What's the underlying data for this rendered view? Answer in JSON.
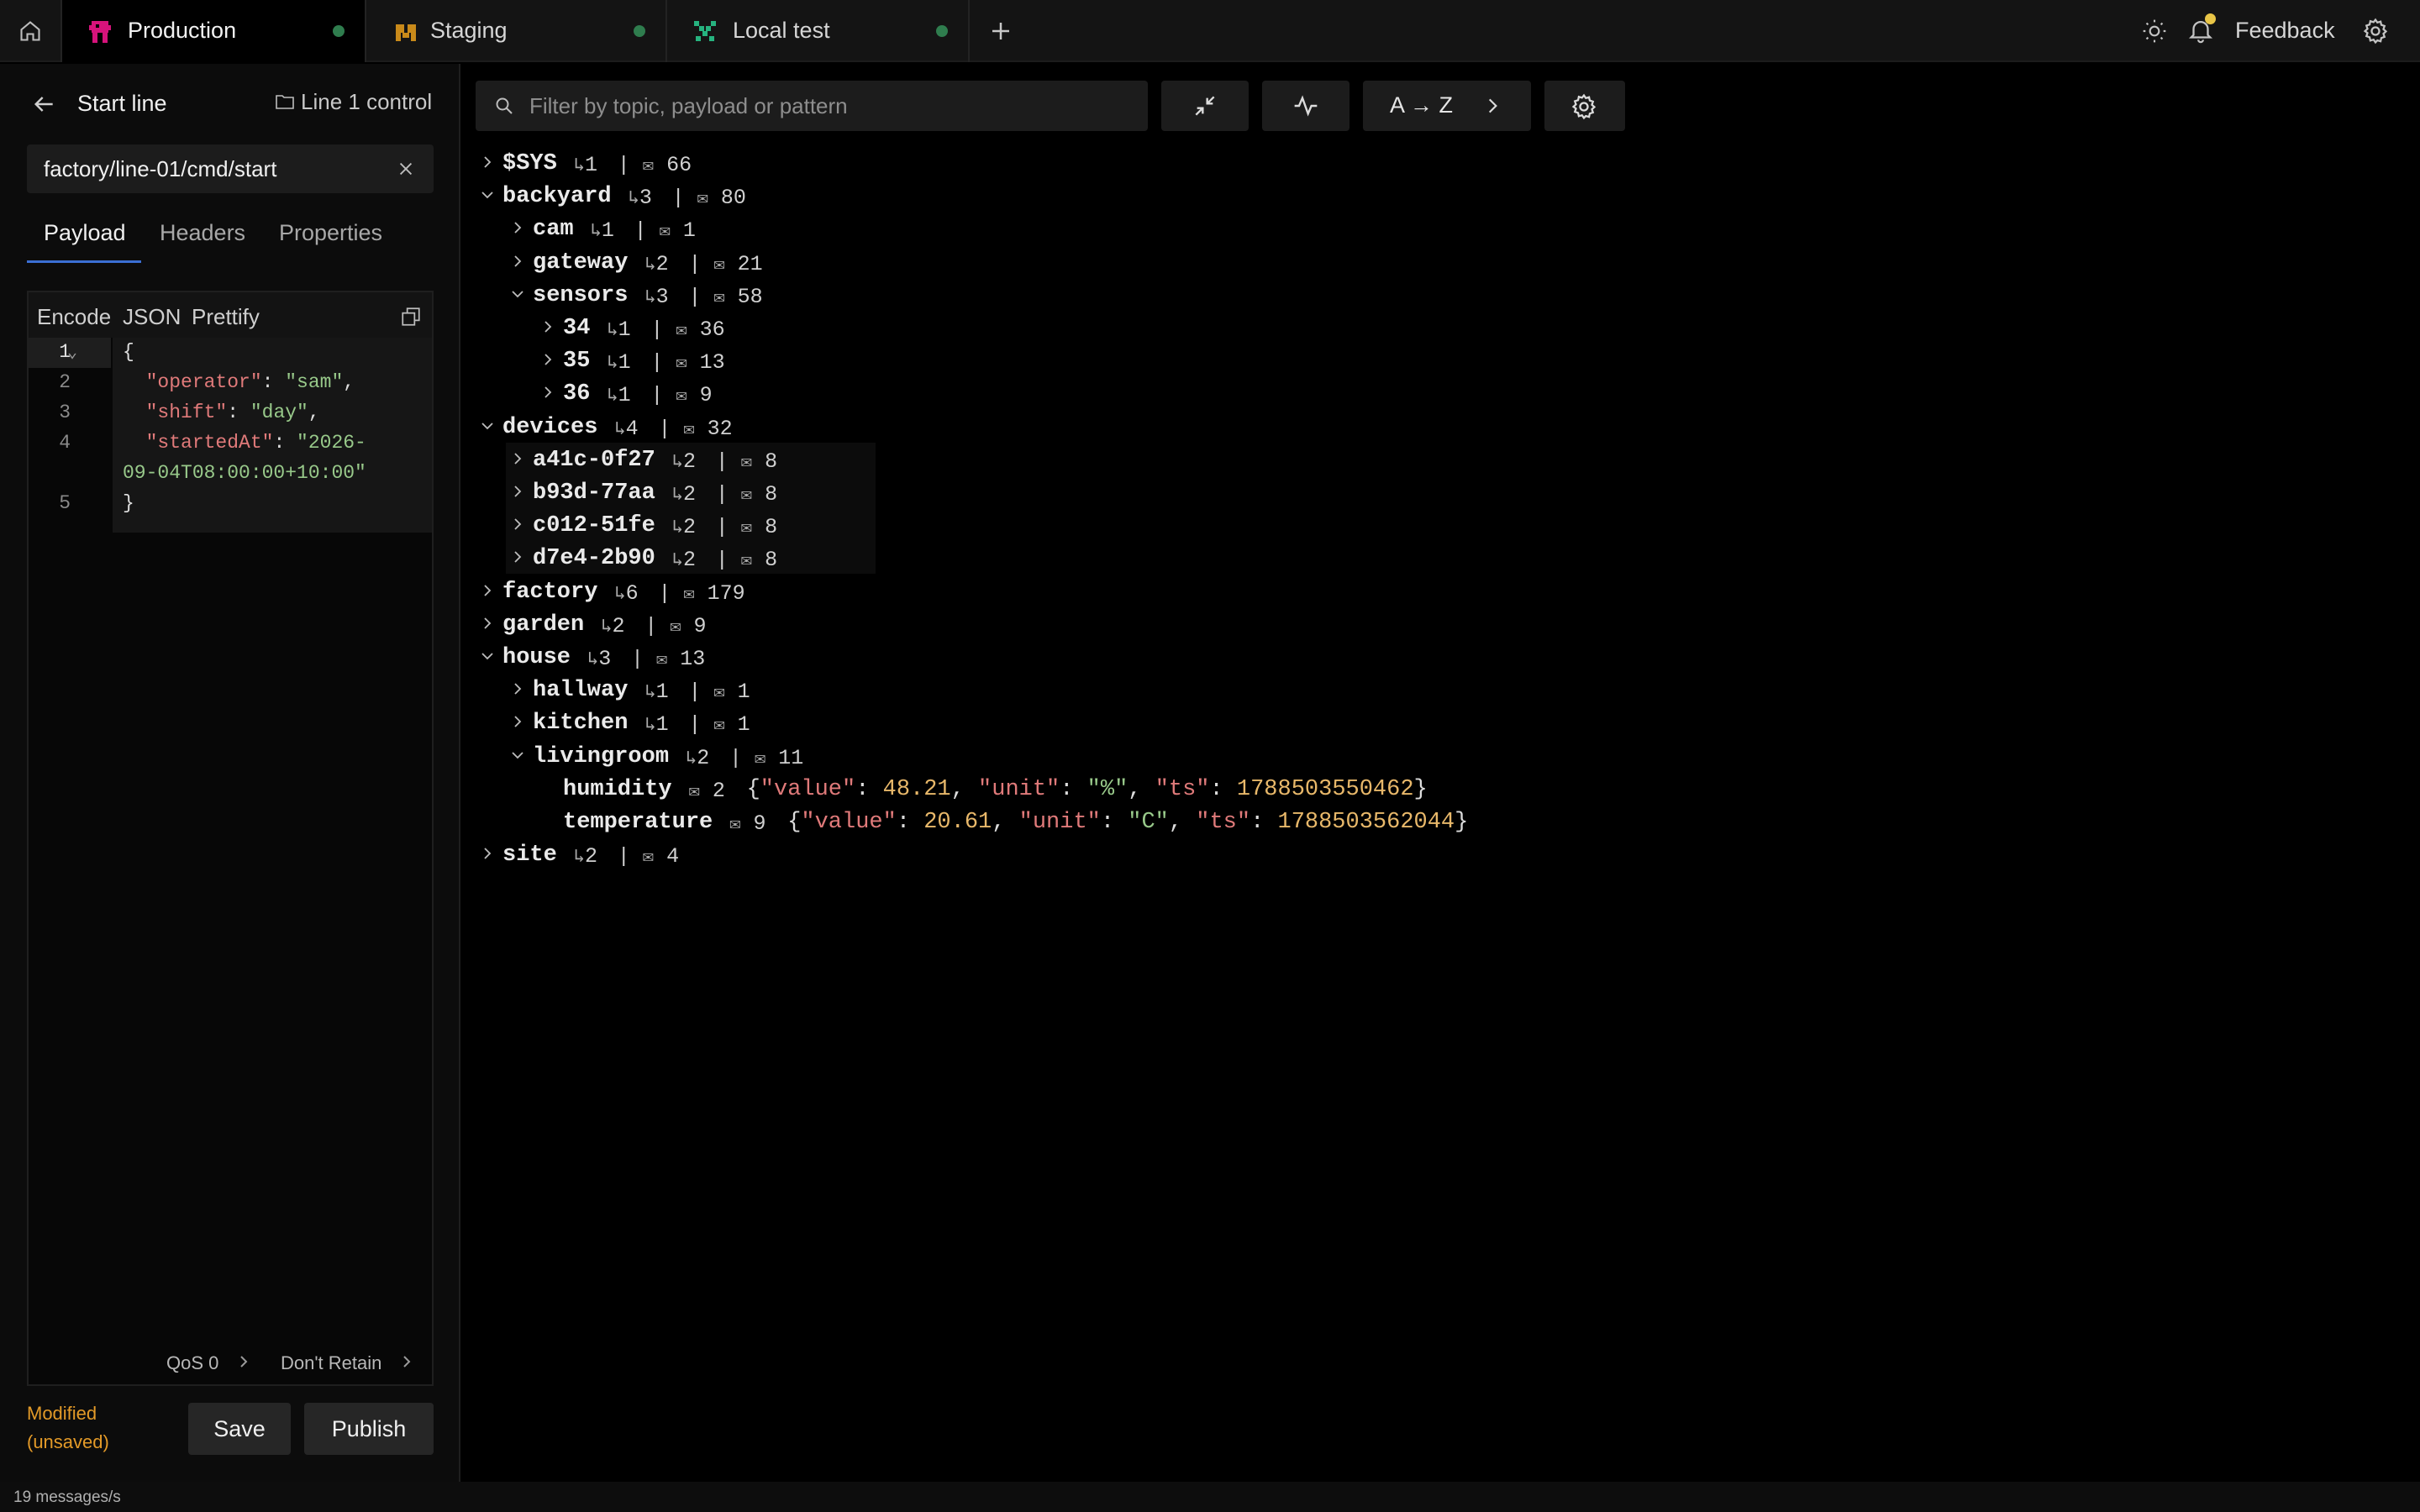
{
  "tabs": [
    {
      "label": "Production",
      "icon": "production-logo-icon",
      "active": true
    },
    {
      "label": "Staging",
      "icon": "staging-logo-icon",
      "active": false
    },
    {
      "label": "Local test",
      "icon": "local-test-logo-icon",
      "active": false
    }
  ],
  "topbar": {
    "feedback_label": "Feedback"
  },
  "colors": {
    "accent": "#3b6fd4",
    "modified": "#e39a28",
    "connected_dot": "#2f7d4e",
    "notification_badge": "#e8c547",
    "production_icon": "#d6137b",
    "staging_icon": "#c98a1a",
    "local_test_icon": "#26b37f"
  },
  "left": {
    "title": "Start line",
    "folder": "Line 1 control",
    "topic_value": "factory/line-01/cmd/start",
    "subtabs": [
      "Payload",
      "Headers",
      "Properties"
    ],
    "editor_tools": [
      "Encode",
      "JSON",
      "Prettify"
    ],
    "line_numbers": [
      "1",
      "2",
      "3",
      "4",
      "5"
    ],
    "qos_label": "QoS 0",
    "retain_label": "Don't Retain",
    "status": "Modified\n(unsaved)",
    "save_label": "Save",
    "publish_label": "Publish"
  },
  "main": {
    "filter_placeholder": "Filter by topic, payload or pattern",
    "sort_label": "A → Z"
  },
  "tree": [
    {
      "name": "$SYS",
      "children": "1",
      "messages": "66"
    },
    {
      "name": "backyard",
      "children": "3",
      "messages": "80"
    },
    {
      "name": "cam",
      "children": "1",
      "messages": "1"
    },
    {
      "name": "gateway",
      "children": "2",
      "messages": "21"
    },
    {
      "name": "sensors",
      "children": "3",
      "messages": "58"
    },
    {
      "name": "34",
      "children": "1",
      "messages": "36"
    },
    {
      "name": "35",
      "children": "1",
      "messages": "13"
    },
    {
      "name": "36",
      "children": "1",
      "messages": "9"
    },
    {
      "name": "devices",
      "children": "4",
      "messages": "32"
    },
    {
      "name": "a41c-0f27",
      "children": "2",
      "messages": "8"
    },
    {
      "name": "b93d-77aa",
      "children": "2",
      "messages": "8"
    },
    {
      "name": "c012-51fe",
      "children": "2",
      "messages": "8"
    },
    {
      "name": "d7e4-2b90",
      "children": "2",
      "messages": "8"
    },
    {
      "name": "factory",
      "children": "6",
      "messages": "179"
    },
    {
      "name": "garden",
      "children": "2",
      "messages": "9"
    },
    {
      "name": "house",
      "children": "3",
      "messages": "13"
    },
    {
      "name": "hallway",
      "children": "1",
      "messages": "1"
    },
    {
      "name": "kitchen",
      "children": "1",
      "messages": "1"
    },
    {
      "name": "livingroom",
      "children": "2",
      "messages": "11"
    },
    {
      "name": "humidity",
      "messages": "2",
      "value": "48.21",
      "unit": "%",
      "ts": "1788503550462"
    },
    {
      "name": "temperature",
      "messages": "9",
      "value": "20.61",
      "unit": "C",
      "ts": "1788503562044"
    },
    {
      "name": "site",
      "children": "2",
      "messages": "4"
    }
  ],
  "statusbar": {
    "rate": "19 messages/s"
  }
}
